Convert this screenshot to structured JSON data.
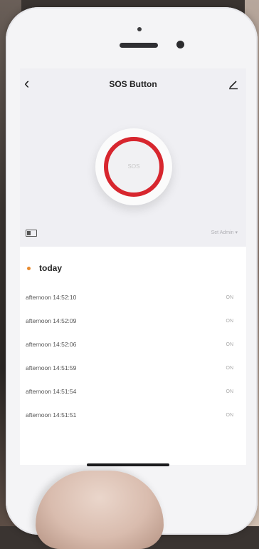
{
  "header": {
    "back_glyph": "‹",
    "title": "SOS Button",
    "edit_icon": "pencil-icon"
  },
  "device": {
    "button_text": "SOS",
    "battery_icon": "battery-icon",
    "admin_selector": "Set Admin ▾",
    "accent_color": "#d7262e"
  },
  "history": {
    "date_label": "today",
    "dot_color": "#e88a2e",
    "records": [
      {
        "time": "afternoon  14:52:10",
        "state": "ON"
      },
      {
        "time": "afternoon  14:52:09",
        "state": "ON"
      },
      {
        "time": "afternoon  14:52:06",
        "state": "ON"
      },
      {
        "time": "afternoon  14:51:59",
        "state": "ON"
      },
      {
        "time": "afternoon  14:51:54",
        "state": "ON"
      },
      {
        "time": "afternoon  14:51:51",
        "state": "ON"
      }
    ]
  }
}
